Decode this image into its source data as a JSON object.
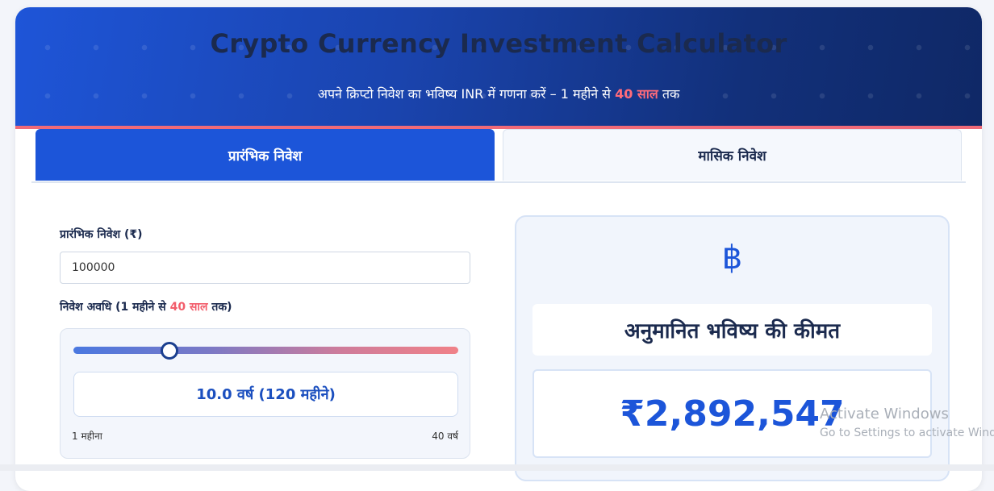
{
  "header": {
    "title": "Crypto Currency Investment Calculator",
    "subtitle_pre": "अपने क्रिप्टो निवेश का भविष्य INR में गणना करें – 1 महीने से ",
    "subtitle_hl": "40 साल",
    "subtitle_post": " तक"
  },
  "tabs": [
    {
      "label": "प्रारंभिक निवेश",
      "active": true
    },
    {
      "label": "मासिक निवेश",
      "active": false
    }
  ],
  "form": {
    "initial_label": "प्रारंभिक निवेश (₹)",
    "initial_value": "100000",
    "duration_label_pre": "निवेश अवधि (1 महीने से ",
    "duration_label_hl": "40 साल",
    "duration_label_post": " तक)",
    "slider": {
      "value_years": 10.0,
      "min_label": "1 महीना",
      "max_label": "40 वर्ष",
      "readout": "10.0 वर्ष (120 महीने)"
    }
  },
  "result": {
    "icon": "bitcoin-icon",
    "icon_glyph": "฿",
    "label": "अनुमानित भविष्य की कीमत",
    "value": "₹2,892,547"
  },
  "watermark": {
    "line1": "Activate Windows",
    "line2": "Go to Settings to activate Windo"
  },
  "colors": {
    "primary": "#1c55d9",
    "accent": "#f25d6b",
    "heading": "#1b2a4e"
  }
}
